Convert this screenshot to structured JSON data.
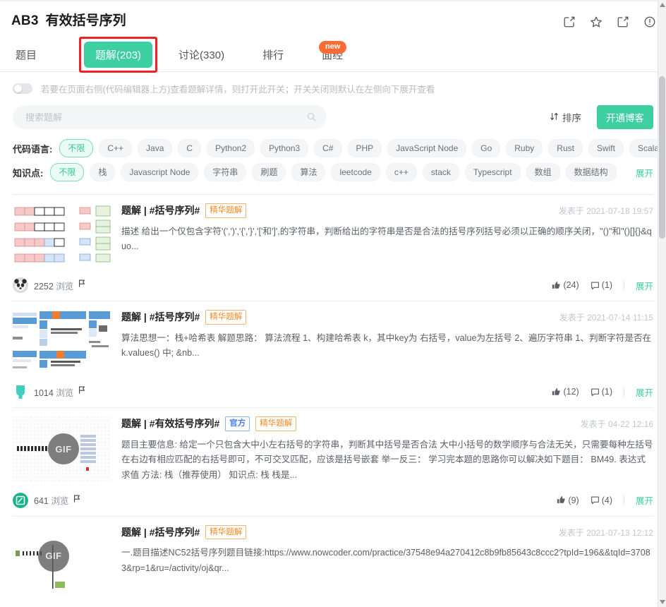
{
  "header": {
    "problem_id": "AB3",
    "problem_title": "有效括号序列",
    "icons": [
      {
        "name": "edit-icon",
        "glyph": "edit"
      },
      {
        "name": "star-icon",
        "glyph": "star"
      },
      {
        "name": "share-icon",
        "glyph": "share"
      },
      {
        "name": "info-icon",
        "glyph": "info"
      }
    ]
  },
  "tabs": {
    "items": [
      {
        "label": "题目",
        "active": false
      },
      {
        "label": "题解(203)",
        "active": true
      },
      {
        "label": "讨论(330)",
        "active": false
      },
      {
        "label": "排行",
        "active": false
      },
      {
        "label": "面经",
        "active": false
      }
    ],
    "new_badge": "new",
    "active_index": 1,
    "highlight_color": "#ee2222",
    "active_color": "#3ecfa0"
  },
  "toggle": {
    "state": "off",
    "description": "若要在页面右侧(代码编辑器上方)查看题解详情，则打开此开关；开关关闭则默认在左侧向下展开查看"
  },
  "search": {
    "placeholder": "搜索题解",
    "value": "",
    "icon": "search-icon"
  },
  "toolbar": {
    "sort_label": "排序",
    "sort_icon": "sort-arrows-icon",
    "blog_label": "开通博客",
    "blog_color": "#3ecfa0"
  },
  "filters": {
    "language": {
      "label": "代码语言:",
      "tags": [
        "不限",
        "C++",
        "Java",
        "C",
        "Python2",
        "Python3",
        "C#",
        "PHP",
        "JavaScript Node",
        "Go",
        "Ruby",
        "Rust",
        "Swift",
        "Scala"
      ],
      "selected": "不限"
    },
    "knowledge": {
      "label": "知识点:",
      "tags": [
        "不限",
        "栈",
        "Javascript Node",
        "字符串",
        "刷题",
        "算法",
        "leetcode",
        "c++",
        "stack",
        "Typescript",
        "数组",
        "数据结构"
      ],
      "selected": "不限",
      "expand_label": "展开"
    }
  },
  "posts": [
    {
      "title": "题解 | #括号序列#",
      "badges": [
        "精华题解"
      ],
      "official": false,
      "date": "发表于 2021-07-18 19:57",
      "excerpt": "描述     给出一个仅包含字符'(',')','{','}','['和']',的字符串，判断给出的字符串是否是合法的括号序列括号必须以正确的顺序关闭，\"()\"和\"()[]{}&quo...",
      "views": "2252",
      "views_label": "浏览",
      "likes": "(24)",
      "comments": "(1)",
      "expand_label": "展开",
      "thumb_type": "diagram",
      "avatar_type": "panda"
    },
    {
      "title": "题解 | #括号序列#",
      "badges": [
        "精华题解"
      ],
      "official": false,
      "date": "发表于 2021-07-14 11:15",
      "excerpt": "算法思想一：栈+哈希表 解题思路： 算法流程 1、构建哈希表 k，其中key为 右括号，value为左括号 2、遍历字符串    1、判断字符是否在 k.values() 中;     &nb...",
      "views": "1014",
      "views_label": "浏览",
      "likes": "(12)",
      "comments": "(1)",
      "expand_label": "展开",
      "thumb_type": "table",
      "avatar_type": "teal"
    },
    {
      "title": "题解 | #有效括号序列#",
      "badges": [
        "官方",
        "精华题解"
      ],
      "official": true,
      "date": "发表于 04-22 12:16",
      "excerpt": "题目主要信息: 给定一个只包含大中小左右括号的字符串，判断其中括号是否合法 大中小括号的数学顺序与合法无关，只需要每种左括号在右边有相应匹配的右括号即可，不可交叉匹配，应该是括号嵌套 举一反三： 学习完本题的思路你可以解决如下题目： BM49. 表达式求值 方法: 栈（推荐使用） 知识点: 栈 栈是...",
      "views": "641",
      "views_label": "浏览",
      "likes": "(9)",
      "comments": "(4)",
      "expand_label": "展开",
      "thumb_type": "gif",
      "avatar_type": "green-logo"
    },
    {
      "title": "题解 | #括号序列#",
      "badges": [
        "精华题解"
      ],
      "official": false,
      "date": "发表于 2021-07-13 12:12",
      "excerpt": "一.题目描述NC52括号序列题目链接:https://www.nowcoder.com/practice/37548e94a270412c8b9fb85643c8ccc2?tpId=196&&tqId=37083&rp=1&ru=/activity/oj&qr...",
      "views": "",
      "views_label": "",
      "likes": "",
      "comments": "",
      "expand_label": "",
      "thumb_type": "gif2",
      "avatar_type": "none"
    }
  ]
}
